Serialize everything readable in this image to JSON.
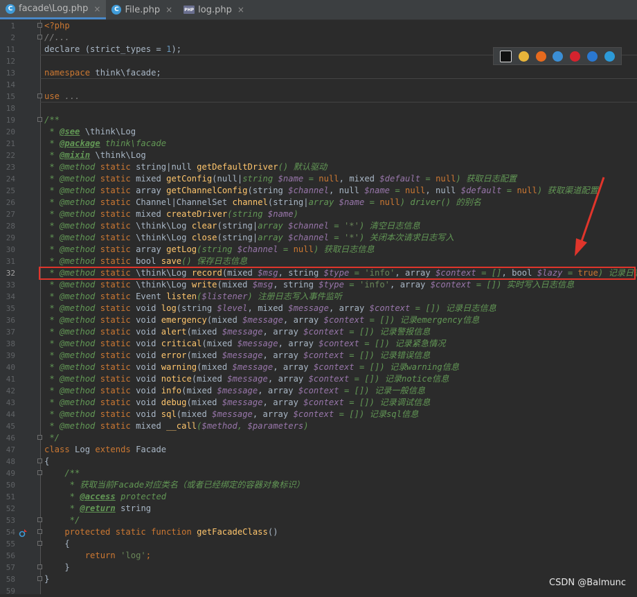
{
  "tabs": [
    {
      "label": "facade\\Log.php",
      "icon": "php-class-icon",
      "active": true
    },
    {
      "label": "File.php",
      "icon": "php-class-icon",
      "active": false
    },
    {
      "label": "log.php",
      "icon": "php-file-icon",
      "active": false
    }
  ],
  "close_glyph": "×",
  "browser_icons": [
    "phpstorm-icon",
    "chrome-icon",
    "firefox-icon",
    "safari-icon",
    "opera-icon",
    "ie-icon",
    "edge-icon"
  ],
  "browser_colors": {
    "phpstorm": "#111111",
    "chrome": "#e7b43a",
    "firefox": "#e66a1e",
    "safari": "#3b8fd6",
    "opera": "#d4232e",
    "ie": "#2a78d1",
    "edge": "#2c9ad8"
  },
  "highlight_color": "#e0352b",
  "watermark": "CSDN @Balmunc",
  "current_line": 32,
  "lines": [
    {
      "n": "1",
      "fold": true,
      "segs": [
        [
          "k",
          "<?php"
        ]
      ]
    },
    {
      "n": "2",
      "fold": true,
      "segs": [
        [
          "g",
          "//..."
        ]
      ]
    },
    {
      "n": "11",
      "segs": [
        [
          "",
          "declare (strict_types = "
        ],
        [
          "n",
          "1"
        ],
        [
          "",
          ");"
        ]
      ],
      "sep": true
    },
    {
      "n": "12",
      "segs": []
    },
    {
      "n": "13",
      "segs": [
        [
          "k",
          "namespace "
        ],
        [
          "",
          "think\\facade;"
        ]
      ],
      "sep": true
    },
    {
      "n": "14",
      "segs": []
    },
    {
      "n": "15",
      "fold": true,
      "segs": [
        [
          "k",
          "use "
        ],
        [
          "g",
          "..."
        ]
      ],
      "sep": true
    },
    {
      "n": "18",
      "segs": []
    },
    {
      "n": "19",
      "fold": true,
      "segs": [
        [
          "c",
          "/**"
        ]
      ]
    },
    {
      "n": "20",
      "segs": [
        [
          "c",
          " * "
        ],
        [
          "t",
          "@see"
        ],
        [
          "c",
          " "
        ],
        [
          "",
          "\\think\\Log"
        ]
      ]
    },
    {
      "n": "21",
      "segs": [
        [
          "c",
          " * "
        ],
        [
          "t",
          "@package"
        ],
        [
          "c",
          " think\\facade"
        ]
      ]
    },
    {
      "n": "22",
      "segs": [
        [
          "c",
          " * "
        ],
        [
          "t",
          "@mixin"
        ],
        [
          "c",
          " "
        ],
        [
          "",
          "\\think\\Log"
        ]
      ]
    },
    {
      "n": "23",
      "segs": [
        [
          "c",
          " * @method "
        ],
        [
          "k",
          "static "
        ],
        [
          "",
          "string|null "
        ],
        [
          "f",
          "getDefaultDriver"
        ],
        [
          "c",
          "() 默认驱动"
        ]
      ]
    },
    {
      "n": "24",
      "segs": [
        [
          "c",
          " * @method "
        ],
        [
          "k",
          "static "
        ],
        [
          "",
          "mixed "
        ],
        [
          "f",
          "getConfig"
        ],
        [
          "",
          "(null|"
        ],
        [
          "c",
          "string "
        ],
        [
          "v",
          "$name"
        ],
        [
          "c",
          " = "
        ],
        [
          "k",
          "null"
        ],
        [
          "",
          ", mixed "
        ],
        [
          "v",
          "$default"
        ],
        [
          "c",
          " = "
        ],
        [
          "k",
          "null"
        ],
        [
          "c",
          ") 获取日志配置"
        ]
      ]
    },
    {
      "n": "25",
      "segs": [
        [
          "c",
          " * @method "
        ],
        [
          "k",
          "static "
        ],
        [
          "",
          "array "
        ],
        [
          "f",
          "getChannelConfig"
        ],
        [
          "",
          "(string "
        ],
        [
          "v",
          "$channel"
        ],
        [
          "",
          ", null "
        ],
        [
          "v",
          "$name"
        ],
        [
          "c",
          " = "
        ],
        [
          "k",
          "null"
        ],
        [
          "",
          ", null "
        ],
        [
          "v",
          "$default"
        ],
        [
          "c",
          " = "
        ],
        [
          "k",
          "null"
        ],
        [
          "c",
          ") 获取渠道配置"
        ]
      ]
    },
    {
      "n": "26",
      "segs": [
        [
          "c",
          " * @method "
        ],
        [
          "k",
          "static "
        ],
        [
          "",
          "Channel|ChannelSet "
        ],
        [
          "f",
          "channel"
        ],
        [
          "",
          "(string|"
        ],
        [
          "c",
          "array "
        ],
        [
          "v",
          "$name"
        ],
        [
          "c",
          " = "
        ],
        [
          "k",
          "null"
        ],
        [
          "c",
          ") driver() 的别名"
        ]
      ]
    },
    {
      "n": "27",
      "segs": [
        [
          "c",
          " * @method "
        ],
        [
          "k",
          "static "
        ],
        [
          "",
          "mixed "
        ],
        [
          "f",
          "createDriver"
        ],
        [
          "c",
          "(string "
        ],
        [
          "v",
          "$name"
        ],
        [
          "c",
          ")"
        ]
      ]
    },
    {
      "n": "28",
      "segs": [
        [
          "c",
          " * @method "
        ],
        [
          "k",
          "static "
        ],
        [
          "",
          "\\think\\Log "
        ],
        [
          "f",
          "clear"
        ],
        [
          "",
          "(string|"
        ],
        [
          "c",
          "array "
        ],
        [
          "v",
          "$channel"
        ],
        [
          "c",
          " = "
        ],
        [
          "s",
          "'*'"
        ],
        [
          "c",
          ") 清空日志信息"
        ]
      ]
    },
    {
      "n": "29",
      "segs": [
        [
          "c",
          " * @method "
        ],
        [
          "k",
          "static "
        ],
        [
          "",
          "\\think\\Log "
        ],
        [
          "f",
          "close"
        ],
        [
          "",
          "(string|"
        ],
        [
          "c",
          "array "
        ],
        [
          "v",
          "$channel"
        ],
        [
          "c",
          " = "
        ],
        [
          "s",
          "'*'"
        ],
        [
          "c",
          ") 关闭本次请求日志写入"
        ]
      ]
    },
    {
      "n": "30",
      "segs": [
        [
          "c",
          " * @method "
        ],
        [
          "k",
          "static "
        ],
        [
          "",
          "array "
        ],
        [
          "f",
          "getLog"
        ],
        [
          "c",
          "(string "
        ],
        [
          "v",
          "$channel"
        ],
        [
          "c",
          " = "
        ],
        [
          "k",
          "null"
        ],
        [
          "c",
          ") 获取日志信息"
        ]
      ]
    },
    {
      "n": "31",
      "segs": [
        [
          "c",
          " * @method "
        ],
        [
          "k",
          "static "
        ],
        [
          "",
          "bool "
        ],
        [
          "f",
          "save"
        ],
        [
          "c",
          "() 保存日志信息"
        ]
      ]
    },
    {
      "n": "32",
      "segs": [
        [
          "c",
          " * @method "
        ],
        [
          "k",
          "static "
        ],
        [
          "",
          "\\think\\Log "
        ],
        [
          "f",
          "record"
        ],
        [
          "",
          "(mixed "
        ],
        [
          "v",
          "$msg"
        ],
        [
          "",
          ", string "
        ],
        [
          "v",
          "$type"
        ],
        [
          "c",
          " = "
        ],
        [
          "s",
          "'info'"
        ],
        [
          "",
          ", array "
        ],
        [
          "v",
          "$context"
        ],
        [
          "c",
          " = []"
        ],
        [
          "",
          ", bool "
        ],
        [
          "v",
          "$lazy"
        ],
        [
          "c",
          " = "
        ],
        [
          "k",
          "true"
        ],
        [
          "c",
          ") 记录日志信息"
        ]
      ]
    },
    {
      "n": "33",
      "segs": [
        [
          "c",
          " * @method "
        ],
        [
          "k",
          "static "
        ],
        [
          "",
          "\\think\\Log "
        ],
        [
          "f",
          "write"
        ],
        [
          "",
          "(mixed "
        ],
        [
          "v",
          "$msg"
        ],
        [
          "",
          ", string "
        ],
        [
          "v",
          "$type"
        ],
        [
          "c",
          " = "
        ],
        [
          "s",
          "'info'"
        ],
        [
          "",
          ", array "
        ],
        [
          "v",
          "$context"
        ],
        [
          "c",
          " = []) 实时写入日志信息"
        ]
      ]
    },
    {
      "n": "34",
      "segs": [
        [
          "c",
          " * @method "
        ],
        [
          "k",
          "static "
        ],
        [
          "",
          "Event "
        ],
        [
          "f",
          "listen"
        ],
        [
          "c",
          "("
        ],
        [
          "v",
          "$listener"
        ],
        [
          "c",
          ") 注册日志写入事件监听"
        ]
      ]
    },
    {
      "n": "35",
      "segs": [
        [
          "c",
          " * @method "
        ],
        [
          "k",
          "static "
        ],
        [
          "",
          "void "
        ],
        [
          "f",
          "log"
        ],
        [
          "",
          "(string "
        ],
        [
          "v",
          "$level"
        ],
        [
          "",
          ", mixed "
        ],
        [
          "v",
          "$message"
        ],
        [
          "",
          ", array "
        ],
        [
          "v",
          "$context"
        ],
        [
          "c",
          " = []) 记录日志信息"
        ]
      ]
    },
    {
      "n": "36",
      "segs": [
        [
          "c",
          " * @method "
        ],
        [
          "k",
          "static "
        ],
        [
          "",
          "void "
        ],
        [
          "f",
          "emergency"
        ],
        [
          "",
          "(mixed "
        ],
        [
          "v",
          "$message"
        ],
        [
          "",
          ", array "
        ],
        [
          "v",
          "$context"
        ],
        [
          "c",
          " = []) 记录emergency信息"
        ]
      ]
    },
    {
      "n": "37",
      "segs": [
        [
          "c",
          " * @method "
        ],
        [
          "k",
          "static "
        ],
        [
          "",
          "void "
        ],
        [
          "f",
          "alert"
        ],
        [
          "",
          "(mixed "
        ],
        [
          "v",
          "$message"
        ],
        [
          "",
          ", array "
        ],
        [
          "v",
          "$context"
        ],
        [
          "c",
          " = []) 记录警报信息"
        ]
      ]
    },
    {
      "n": "38",
      "segs": [
        [
          "c",
          " * @method "
        ],
        [
          "k",
          "static "
        ],
        [
          "",
          "void "
        ],
        [
          "f",
          "critical"
        ],
        [
          "",
          "(mixed "
        ],
        [
          "v",
          "$message"
        ],
        [
          "",
          ", array "
        ],
        [
          "v",
          "$context"
        ],
        [
          "c",
          " = []) 记录紧急情况"
        ]
      ]
    },
    {
      "n": "39",
      "segs": [
        [
          "c",
          " * @method "
        ],
        [
          "k",
          "static "
        ],
        [
          "",
          "void "
        ],
        [
          "f",
          "error"
        ],
        [
          "",
          "(mixed "
        ],
        [
          "v",
          "$message"
        ],
        [
          "",
          ", array "
        ],
        [
          "v",
          "$context"
        ],
        [
          "c",
          " = []) 记录错误信息"
        ]
      ]
    },
    {
      "n": "40",
      "segs": [
        [
          "c",
          " * @method "
        ],
        [
          "k",
          "static "
        ],
        [
          "",
          "void "
        ],
        [
          "f",
          "warning"
        ],
        [
          "",
          "(mixed "
        ],
        [
          "v",
          "$message"
        ],
        [
          "",
          ", array "
        ],
        [
          "v",
          "$context"
        ],
        [
          "c",
          " = []) 记录warning信息"
        ]
      ]
    },
    {
      "n": "41",
      "segs": [
        [
          "c",
          " * @method "
        ],
        [
          "k",
          "static "
        ],
        [
          "",
          "void "
        ],
        [
          "f",
          "notice"
        ],
        [
          "",
          "(mixed "
        ],
        [
          "v",
          "$message"
        ],
        [
          "",
          ", array "
        ],
        [
          "v",
          "$context"
        ],
        [
          "c",
          " = []) 记录notice信息"
        ]
      ]
    },
    {
      "n": "42",
      "segs": [
        [
          "c",
          " * @method "
        ],
        [
          "k",
          "static "
        ],
        [
          "",
          "void "
        ],
        [
          "f",
          "info"
        ],
        [
          "",
          "(mixed "
        ],
        [
          "v",
          "$message"
        ],
        [
          "",
          ", array "
        ],
        [
          "v",
          "$context"
        ],
        [
          "c",
          " = []) 记录一般信息"
        ]
      ]
    },
    {
      "n": "43",
      "segs": [
        [
          "c",
          " * @method "
        ],
        [
          "k",
          "static "
        ],
        [
          "",
          "void "
        ],
        [
          "f",
          "debug"
        ],
        [
          "",
          "(mixed "
        ],
        [
          "v",
          "$message"
        ],
        [
          "",
          ", array "
        ],
        [
          "v",
          "$context"
        ],
        [
          "c",
          " = []) 记录调试信息"
        ]
      ]
    },
    {
      "n": "44",
      "segs": [
        [
          "c",
          " * @method "
        ],
        [
          "k",
          "static "
        ],
        [
          "",
          "void "
        ],
        [
          "f",
          "sql"
        ],
        [
          "",
          "(mixed "
        ],
        [
          "v",
          "$message"
        ],
        [
          "",
          ", array "
        ],
        [
          "v",
          "$context"
        ],
        [
          "c",
          " = []) 记录sql信息"
        ]
      ]
    },
    {
      "n": "45",
      "segs": [
        [
          "c",
          " * @method "
        ],
        [
          "k",
          "static "
        ],
        [
          "",
          "mixed "
        ],
        [
          "f",
          "__call"
        ],
        [
          "c",
          "("
        ],
        [
          "v",
          "$method"
        ],
        [
          "c",
          ", "
        ],
        [
          "v",
          "$parameters"
        ],
        [
          "c",
          ")"
        ]
      ]
    },
    {
      "n": "46",
      "fold": true,
      "segs": [
        [
          "c",
          " */"
        ]
      ]
    },
    {
      "n": "47",
      "segs": [
        [
          "k",
          "class "
        ],
        [
          "",
          "Log "
        ],
        [
          "k",
          "extends "
        ],
        [
          "",
          "Facade"
        ]
      ]
    },
    {
      "n": "48",
      "fold": true,
      "segs": [
        [
          "",
          "{"
        ]
      ]
    },
    {
      "n": "49",
      "fold": true,
      "segs": [
        [
          "c",
          "    /**"
        ]
      ]
    },
    {
      "n": "50",
      "segs": [
        [
          "c",
          "     * 获取当前Facade对应类名（或者已经绑定的容器对象标识）"
        ]
      ]
    },
    {
      "n": "51",
      "segs": [
        [
          "c",
          "     * "
        ],
        [
          "t",
          "@access"
        ],
        [
          "c",
          " protected"
        ]
      ]
    },
    {
      "n": "52",
      "segs": [
        [
          "c",
          "     * "
        ],
        [
          "t",
          "@return"
        ],
        [
          "c",
          " "
        ],
        [
          "",
          "string"
        ]
      ]
    },
    {
      "n": "53",
      "fold": true,
      "segs": [
        [
          "c",
          "     */"
        ]
      ]
    },
    {
      "n": "54",
      "gicon": true,
      "fold": true,
      "segs": [
        [
          "k",
          "    protected static function "
        ],
        [
          "f",
          "getFacadeClass"
        ],
        [
          "",
          "()"
        ]
      ]
    },
    {
      "n": "55",
      "fold": true,
      "segs": [
        [
          "",
          "    {"
        ]
      ]
    },
    {
      "n": "56",
      "segs": [
        [
          "k",
          "        return "
        ],
        [
          "s",
          "'log'"
        ],
        [
          "k",
          ";"
        ]
      ]
    },
    {
      "n": "57",
      "fold": true,
      "segs": [
        [
          "",
          "    }"
        ]
      ]
    },
    {
      "n": "58",
      "fold": true,
      "segs": [
        [
          "",
          "}"
        ]
      ]
    },
    {
      "n": "59",
      "segs": []
    }
  ]
}
